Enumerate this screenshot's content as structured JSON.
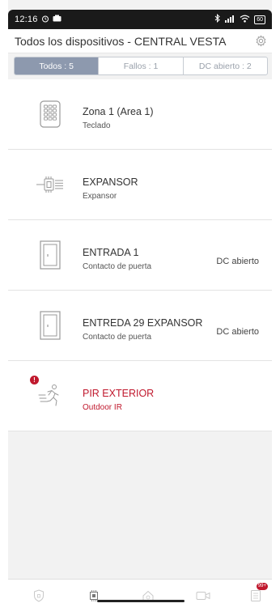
{
  "status_bar": {
    "time": "12:16",
    "battery": "60"
  },
  "app_bar": {
    "title": "Todos los dispositivos - CENTRAL VESTA"
  },
  "tabs": [
    {
      "label": "Todos : 5",
      "active": true
    },
    {
      "label": "Fallos : 1",
      "active": false
    },
    {
      "label": "DC abierto : 2",
      "active": false
    }
  ],
  "devices": [
    {
      "name": "Zona 1 (Area 1)",
      "type": "Teclado",
      "status": "",
      "icon": "keypad-icon",
      "alarm": false
    },
    {
      "name": "EXPANSOR",
      "type": "Expansor",
      "status": "",
      "icon": "expander-icon",
      "alarm": false
    },
    {
      "name": "ENTRADA 1",
      "type": "Contacto de puerta",
      "status": "DC abierto",
      "icon": "door-contact-icon",
      "alarm": false
    },
    {
      "name": "ENTREDA 29 EXPANSOR",
      "type": "Contacto de puerta",
      "status": "DC abierto",
      "icon": "door-contact-icon",
      "alarm": false
    },
    {
      "name": "PIR EXTERIOR",
      "type": "Outdoor IR",
      "status": "",
      "icon": "pir-motion-icon",
      "alarm": true,
      "badge": "!"
    }
  ],
  "bottom_nav": [
    {
      "icon": "shield-icon"
    },
    {
      "icon": "devices-chip-icon",
      "active": true
    },
    {
      "icon": "home-automation-icon"
    },
    {
      "icon": "camera-icon"
    },
    {
      "icon": "events-list-icon",
      "badge": "99+"
    }
  ],
  "colors": {
    "accent_tab": "#8d99ae",
    "alarm_red": "#c0182d",
    "icon_gray": "#9a9a9a"
  }
}
